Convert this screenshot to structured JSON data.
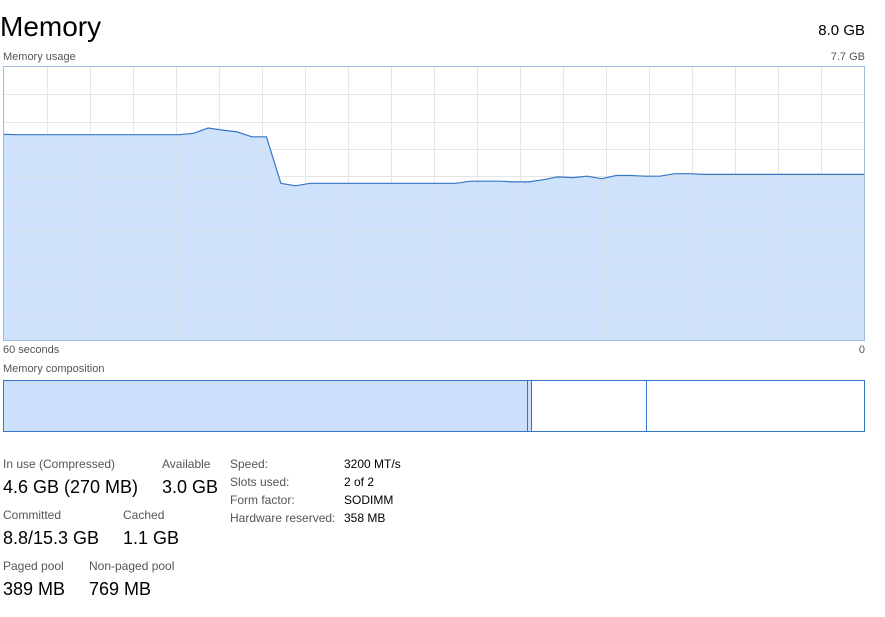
{
  "header": {
    "title": "Memory",
    "total": "8.0 GB"
  },
  "graph": {
    "label": "Memory usage",
    "max_label": "7.7 GB",
    "time_left": "60 seconds",
    "time_right": "0",
    "line_color": "#3576c9",
    "fill_color": "#cce0fb",
    "grid_color": "#e6e6e6",
    "max_gb": 7.7,
    "samples_gb": [
      5.8,
      5.79,
      5.79,
      5.79,
      5.79,
      5.79,
      5.79,
      5.79,
      5.79,
      5.79,
      5.79,
      5.79,
      5.79,
      5.83,
      5.98,
      5.92,
      5.87,
      5.73,
      5.73,
      4.42,
      4.35,
      4.42,
      4.42,
      4.42,
      4.42,
      4.42,
      4.42,
      4.42,
      4.42,
      4.42,
      4.42,
      4.42,
      4.48,
      4.48,
      4.48,
      4.46,
      4.46,
      4.52,
      4.6,
      4.58,
      4.62,
      4.55,
      4.64,
      4.64,
      4.62,
      4.62,
      4.69,
      4.69,
      4.67,
      4.67,
      4.67,
      4.67,
      4.67,
      4.67,
      4.67,
      4.67,
      4.67,
      4.67,
      4.67,
      4.67
    ]
  },
  "composition": {
    "label": "Memory composition",
    "in_use_fraction": 0.609,
    "modified_fraction": 0.005,
    "standby_fraction": 0.134,
    "free_fraction": 0.252
  },
  "stats": {
    "in_use_label": "In use (Compressed)",
    "in_use_value": "4.6 GB (270 MB)",
    "available_label": "Available",
    "available_value": "3.0 GB",
    "committed_label": "Committed",
    "committed_value": "8.8/15.3 GB",
    "cached_label": "Cached",
    "cached_value": "1.1 GB",
    "paged_label": "Paged pool",
    "paged_value": "389 MB",
    "nonpaged_label": "Non-paged pool",
    "nonpaged_value": "769 MB"
  },
  "properties": {
    "speed_label": "Speed:",
    "speed_value": "3200 MT/s",
    "slots_label": "Slots used:",
    "slots_value": "2 of 2",
    "form_label": "Form factor:",
    "form_value": "SODIMM",
    "reserved_label": "Hardware reserved:",
    "reserved_value": "358 MB"
  }
}
